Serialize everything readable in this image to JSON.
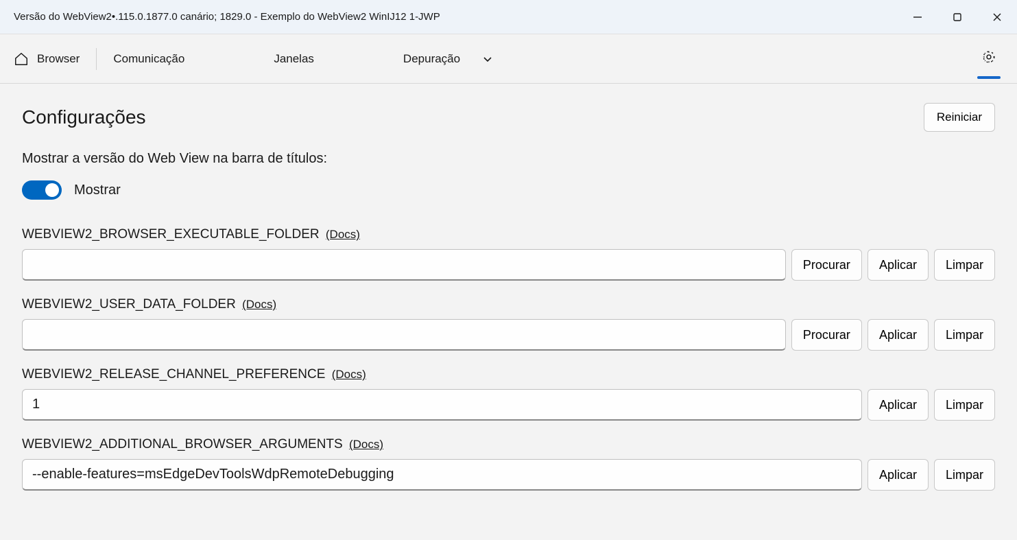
{
  "window": {
    "title": "Versão do WebView2•.115.0.1877.0 canário; 1829.0 - Exemplo do WebView2 WinIJ12 1-JWP"
  },
  "toolbar": {
    "browser": "Browser",
    "communication": "Comunicação",
    "windows": "Janelas",
    "debugging": "Depuração"
  },
  "page": {
    "title": "Configurações",
    "restart_label": "Reiniciar",
    "show_version_label": "Mostrar a versão do Web View na barra de títulos:",
    "toggle_text": "Mostrar"
  },
  "docs_label": "(Docs)",
  "actions": {
    "browse": "Procurar",
    "apply": "Aplicar",
    "clear": "Limpar"
  },
  "env": {
    "executable_folder": {
      "label": "WEBVIEW2_BROWSER_EXECUTABLE_FOLDER",
      "value": ""
    },
    "user_data_folder": {
      "label": "WEBVIEW2_USER_DATA_FOLDER",
      "value": ""
    },
    "release_channel": {
      "label": "WEBVIEW2_RELEASE_CHANNEL_PREFERENCE",
      "value": "1"
    },
    "additional_args": {
      "label": "WEBVIEW2_ADDITIONAL_BROWSER_ARGUMENTS",
      "value": "--enable-features=msEdgeDevToolsWdpRemoteDebugging"
    }
  }
}
